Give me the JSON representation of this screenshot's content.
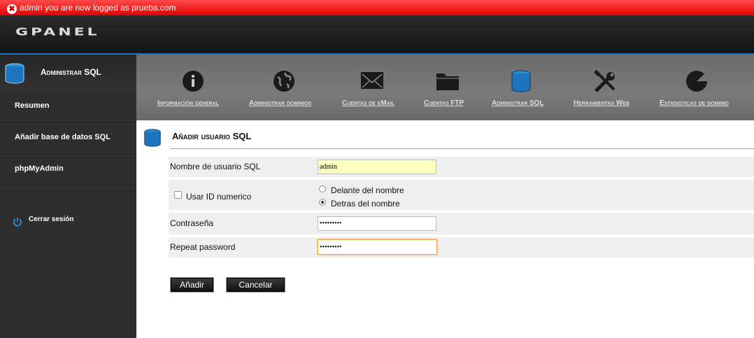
{
  "notice": {
    "message": "admin you are now logged as prueba.com"
  },
  "header": {
    "logo": "GPANEL"
  },
  "sidebar": {
    "title": "Administrar SQL",
    "items": [
      {
        "label": "Resumen"
      },
      {
        "label": "Añadir base de datos SQL"
      },
      {
        "label": "phpMyAdmin"
      }
    ],
    "logout": "Cerrar sesión"
  },
  "topnav": {
    "items": [
      {
        "label": "Información general",
        "icon": "info-icon"
      },
      {
        "label": "Administrar dominios",
        "icon": "globe-icon"
      },
      {
        "label": "Cuentas de eMail",
        "icon": "mail-icon"
      },
      {
        "label": "Cuentas FTP",
        "icon": "folder-icon"
      },
      {
        "label": "Administrar SQL",
        "icon": "database-icon"
      },
      {
        "label": "Herramientas Web",
        "icon": "tools-icon"
      },
      {
        "label": "Estadisticas de dominio",
        "icon": "pie-chart-icon"
      }
    ]
  },
  "form": {
    "title": "Añadir usuario SQL",
    "username_label": "Nombre de usuario SQL",
    "username_value": "admin",
    "numeric_id_label": "Usar ID numerico",
    "numeric_id_checked": false,
    "position_options": [
      "Delante del nombre",
      "Detras del nombre"
    ],
    "position_selected": "Detras del nombre",
    "password_label": "Contraseña",
    "password_value": "•••••••••",
    "repeat_label": "Repeat password",
    "repeat_value": "•••••••••",
    "submit_label": "Añadir",
    "cancel_label": "Cancelar"
  },
  "colors": {
    "notice_red": "#e50000",
    "accent_blue": "#1e6fb6",
    "highlight_input": "#ffffc0",
    "focus_border": "#e8a33c"
  }
}
